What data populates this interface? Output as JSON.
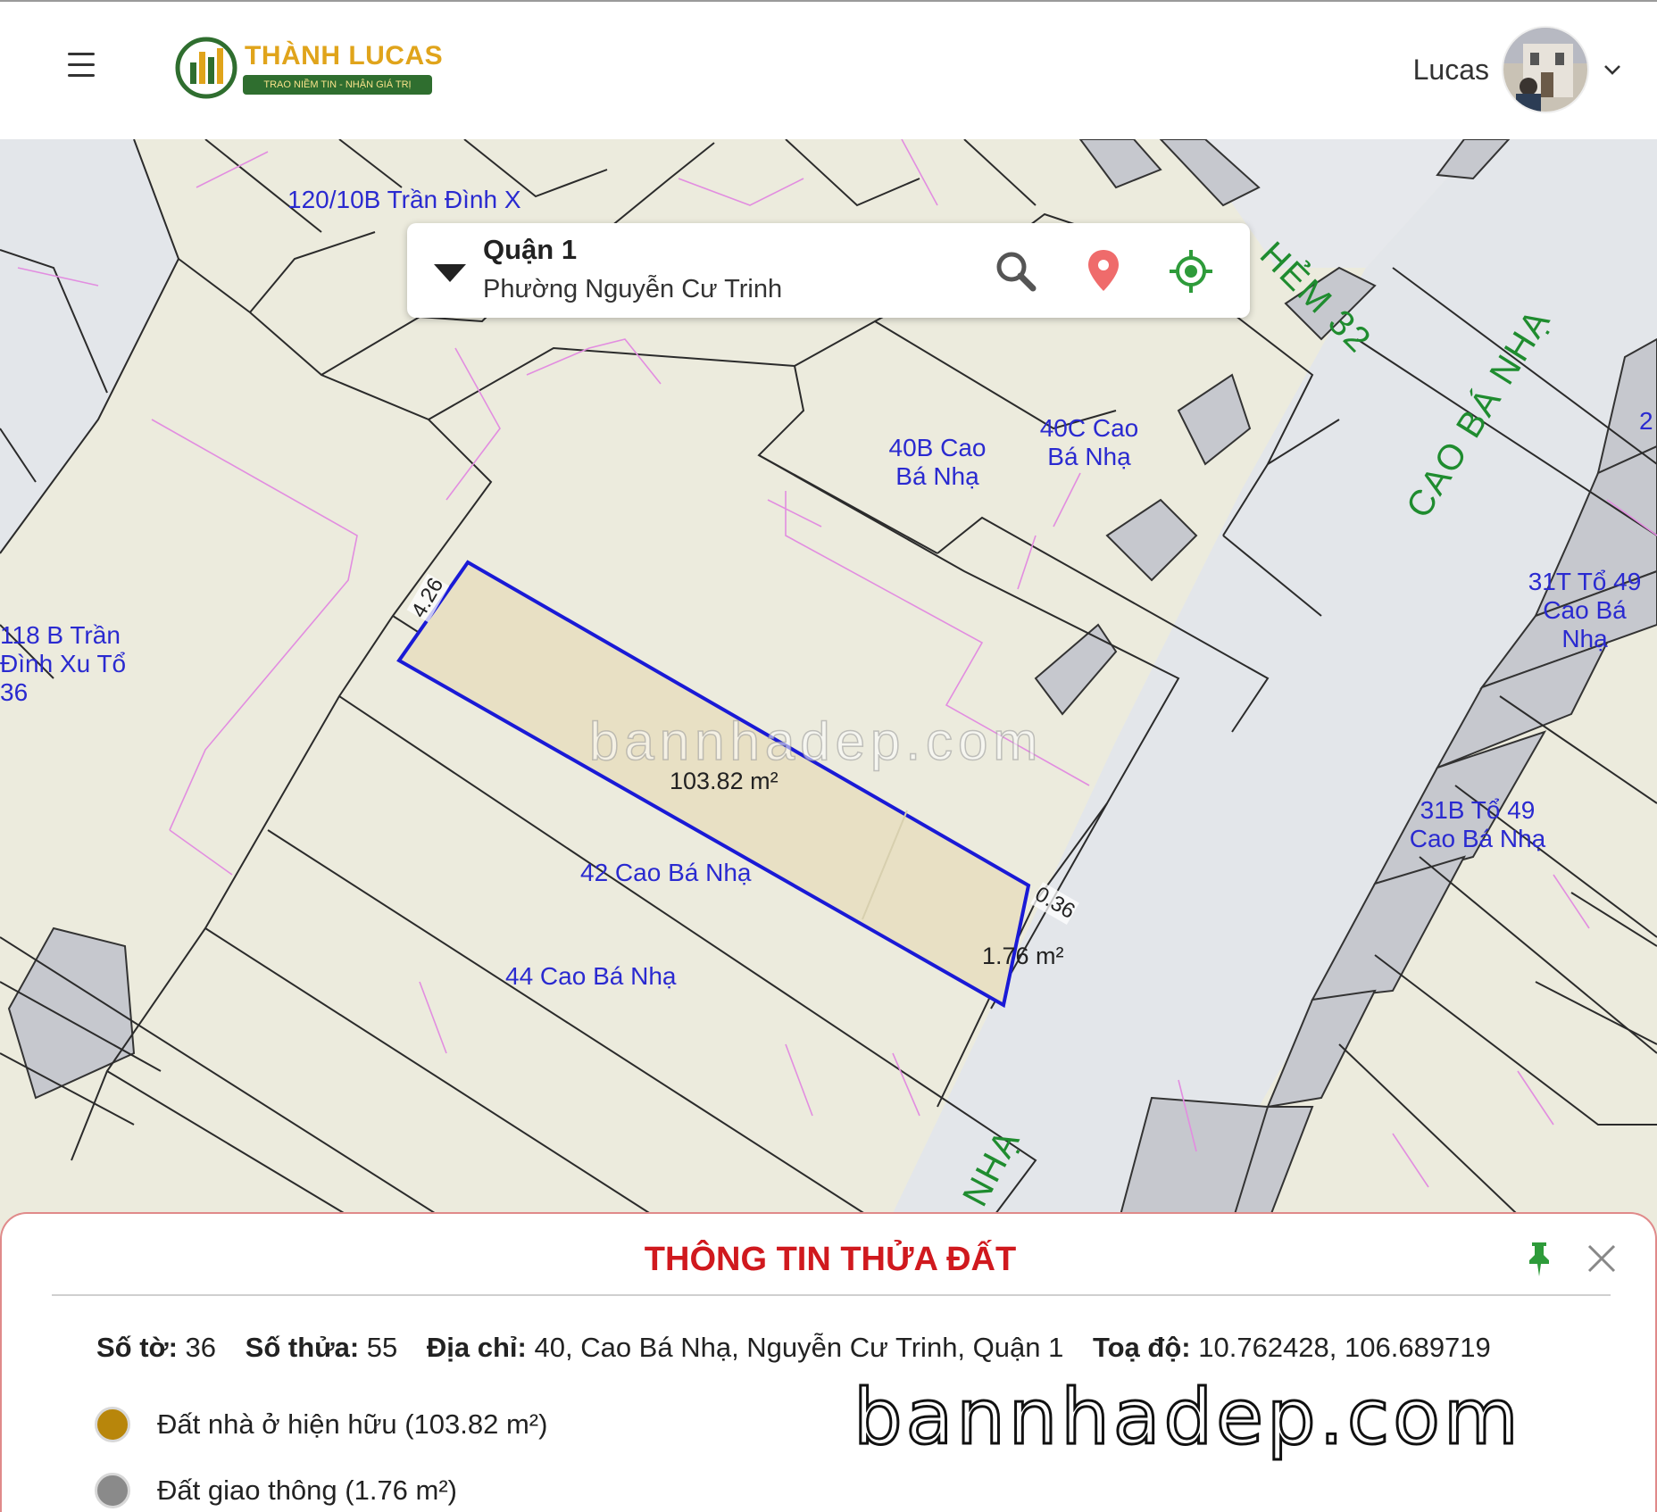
{
  "header": {
    "brand_name": "THÀNH LUCAS",
    "brand_tagline": "TRAO NIỀM TIN - NHẬN GIÁ TRỊ",
    "user_name": "Lucas"
  },
  "location": {
    "district": "Quận 1",
    "ward": "Phường Nguyễn Cư Trinh"
  },
  "map": {
    "parcel_labels": {
      "tran_dinh_xu_120": "120/10B Trần Đình X",
      "tran_dinh_xu_118": "118 B Trần Đình Xu Tổ 36",
      "cao_ba_nha_40b": "40B Cao Bá Nhạ",
      "cao_ba_nha_40c": "40C Cao Bá Nhạ",
      "cao_ba_nha_42": "42 Cao Bá Nhạ",
      "cao_ba_nha_44": "44 Cao Bá Nhạ",
      "cao_ba_nha_31t": "31T Tổ 49 Cao Bá Nhạ",
      "cao_ba_nha_31b": "31B Tổ 49 Cao Bá Nhạ",
      "edge_number": "2"
    },
    "street_labels": {
      "hem_32": "HẺM 32",
      "cao_ba_nha_upper": "CAO BÁ NHẠ",
      "cao_ba_nha_lower": "NHẠ"
    },
    "dimensions": {
      "front_width": "4.26",
      "back_width": "0.36"
    },
    "areas": {
      "main": "103.82 m²",
      "road": "1.76 m²"
    },
    "watermark": "bannhadep.com"
  },
  "info_panel": {
    "title": "THÔNG TIN THỬA ĐẤT",
    "so_to_label": "Số tờ:",
    "so_to_value": "36",
    "so_thua_label": "Số thửa:",
    "so_thua_value": "55",
    "dia_chi_label": "Địa chỉ:",
    "dia_chi_value": "40, Cao Bá Nhạ, Nguyễn Cư Trinh, Quận 1",
    "toa_do_label": "Toạ độ:",
    "toa_do_value": "10.762428, 106.689719",
    "legend": [
      {
        "label": "Đất nhà ở hiện hữu (103.82 m²)",
        "color": "#b8860b"
      },
      {
        "label": "Đất giao thông (1.76 m²)",
        "color": "#8a8a8a"
      }
    ],
    "watermark": "bannhadep.com"
  },
  "colors": {
    "parcel_fill": "#ecebdd",
    "road_fill": "#e3e6ea",
    "building_fill": "#c6c8ce",
    "selected_parcel_outline": "#1a1ad6",
    "street_label": "#1f8c2f",
    "panel_title": "#d0191e",
    "pin_icon": "#2e9b3a"
  }
}
